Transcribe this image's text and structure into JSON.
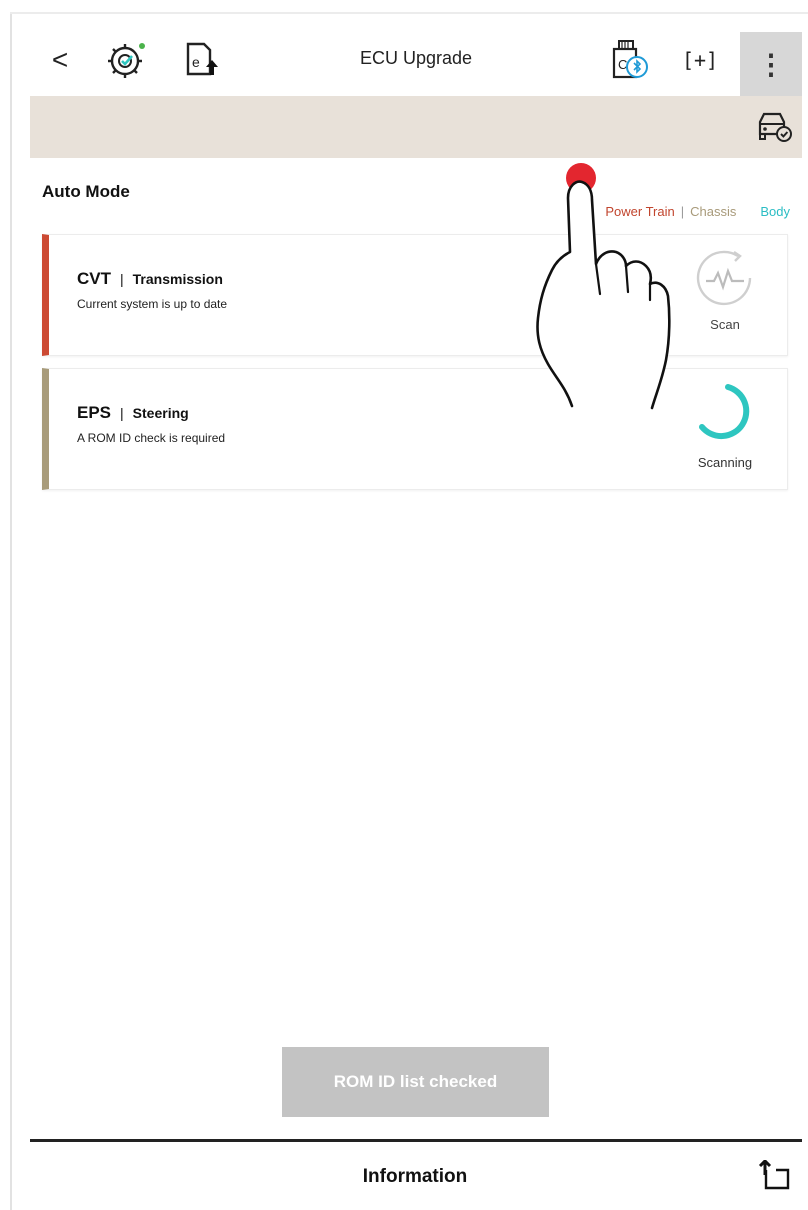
{
  "header": {
    "back_label": "<",
    "title": "ECU Upgrade",
    "screen_label": "[+]",
    "more_label": "⋮"
  },
  "auto_mode": {
    "title": "Auto Mode",
    "filters": {
      "power_train": "Power Train",
      "sep1": "|",
      "chassis": "Chassis",
      "body": "Body"
    }
  },
  "systems": [
    {
      "code": "CVT",
      "separator": "|",
      "system": "Transmission",
      "status": "Current system is up to date",
      "action": "Scan",
      "accent": "#cc4a33"
    },
    {
      "code": "EPS",
      "separator": "|",
      "system": "Steering",
      "status": "A ROM ID check is required",
      "action": "Scanning",
      "accent": "#a89b7a"
    }
  ],
  "rom_button": {
    "label": "ROM ID list checked"
  },
  "footer": {
    "title": "Information"
  },
  "colors": {
    "beige_bar": "#e8e1d9",
    "scanning_teal": "#2ec6c0",
    "button_disabled": "#c3c3c3",
    "touch_indicator": "#e3262f"
  }
}
